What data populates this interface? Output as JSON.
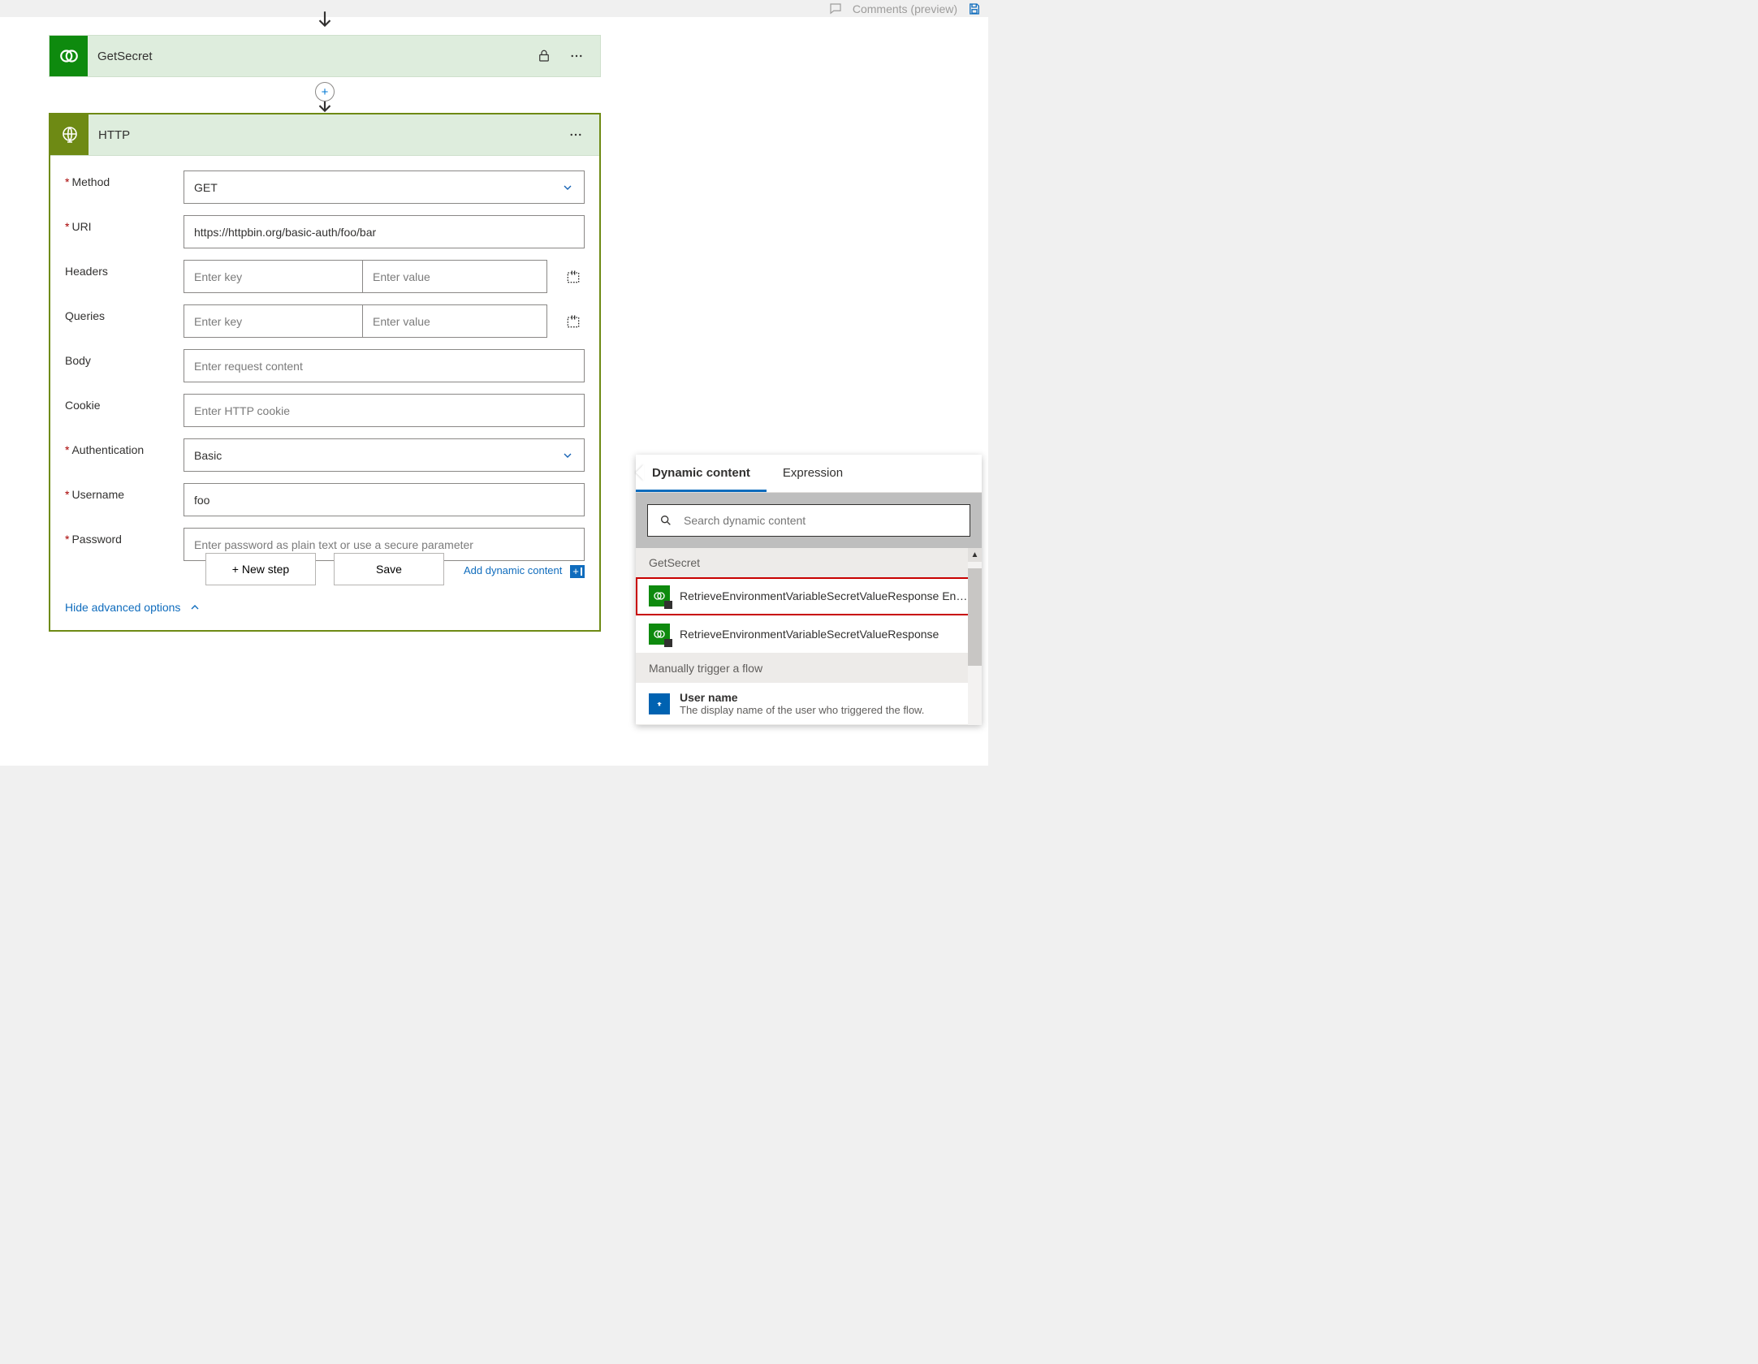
{
  "topbar": {
    "comments_label": "Comments (preview)"
  },
  "get_secret": {
    "title": "GetSecret"
  },
  "http": {
    "title": "HTTP",
    "fields": {
      "method_label": "Method",
      "method_value": "GET",
      "uri_label": "URI",
      "uri_value": "https://httpbin.org/basic-auth/foo/bar",
      "headers_label": "Headers",
      "headers_key_placeholder": "Enter key",
      "headers_value_placeholder": "Enter value",
      "queries_label": "Queries",
      "queries_key_placeholder": "Enter key",
      "queries_value_placeholder": "Enter value",
      "body_label": "Body",
      "body_placeholder": "Enter request content",
      "cookie_label": "Cookie",
      "cookie_placeholder": "Enter HTTP cookie",
      "auth_label": "Authentication",
      "auth_value": "Basic",
      "username_label": "Username",
      "username_value": "foo",
      "password_label": "Password",
      "password_placeholder": "Enter password as plain text or use a secure parameter"
    },
    "add_dynamic_label": "Add dynamic content",
    "hide_advanced_label": "Hide advanced options"
  },
  "footer": {
    "new_step_label": "+ New step",
    "save_label": "Save"
  },
  "dynamic_panel": {
    "tabs": {
      "dynamic": "Dynamic content",
      "expression": "Expression"
    },
    "search_placeholder": "Search dynamic content",
    "groups": {
      "getsecret_header": "GetSecret",
      "getsecret_items": [
        "RetrieveEnvironmentVariableSecretValueResponse Envi…",
        "RetrieveEnvironmentVariableSecretValueResponse"
      ],
      "manual_header": "Manually trigger a flow",
      "manual_item_title": "User name",
      "manual_item_desc": "The display name of the user who triggered the flow."
    }
  }
}
